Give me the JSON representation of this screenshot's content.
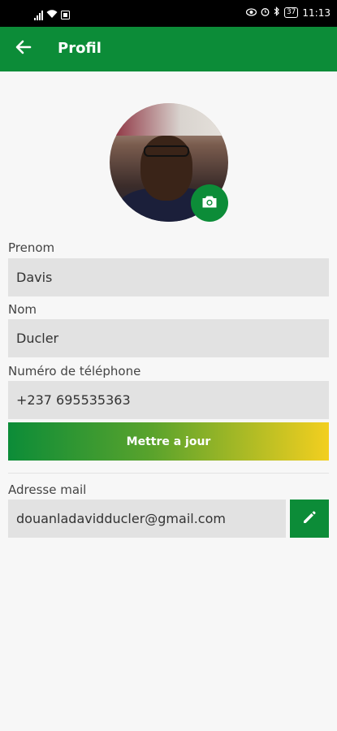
{
  "status_bar": {
    "time": "11:13",
    "battery": "37"
  },
  "app_bar": {
    "title": "Profil",
    "back_icon": "arrow-left-icon"
  },
  "avatar": {
    "camera_icon": "camera-icon"
  },
  "form": {
    "first_name_label": "Prenom",
    "first_name_value": "Davis",
    "last_name_label": "Nom",
    "last_name_value": "Ducler",
    "phone_label": "Numéro de téléphone",
    "phone_value": "+237 695535363",
    "update_button": "Mettre a jour"
  },
  "email": {
    "label": "Adresse mail",
    "value": "douanladavidducler@gmail.com",
    "edit_icon": "pencil-icon"
  },
  "colors": {
    "primary": "#0c8c38",
    "gradient_end": "#f3cf1f",
    "field_bg": "#e2e2e2"
  }
}
